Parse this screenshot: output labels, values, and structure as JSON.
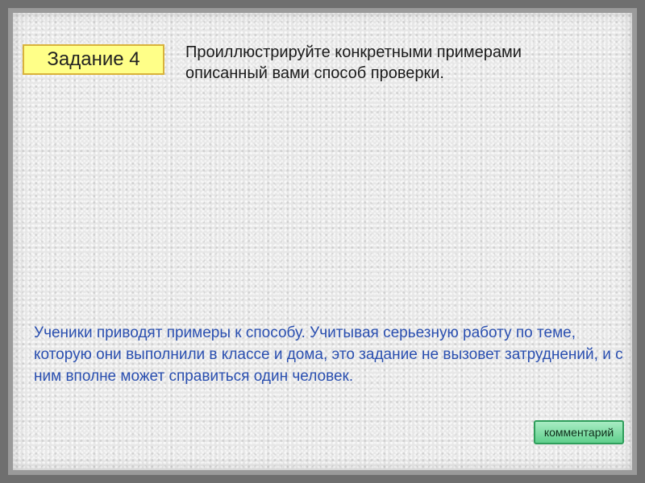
{
  "task": {
    "label": "Задание 4",
    "prompt": "Проиллюстрируйте конкретными примерами описанный вами способ проверки."
  },
  "answer": {
    "text": "Ученики приводят примеры к способу. Учитывая серьезную работу по теме, которую они выполнили в классе и дома, это задание не вызовет затруднений, и с ним вполне может справиться один человек."
  },
  "comment_button": {
    "label": "комментарий"
  },
  "colors": {
    "label_bg": "#ffff88",
    "answer_text": "#2a4fb0",
    "button_bg": "#5fcf8c"
  }
}
